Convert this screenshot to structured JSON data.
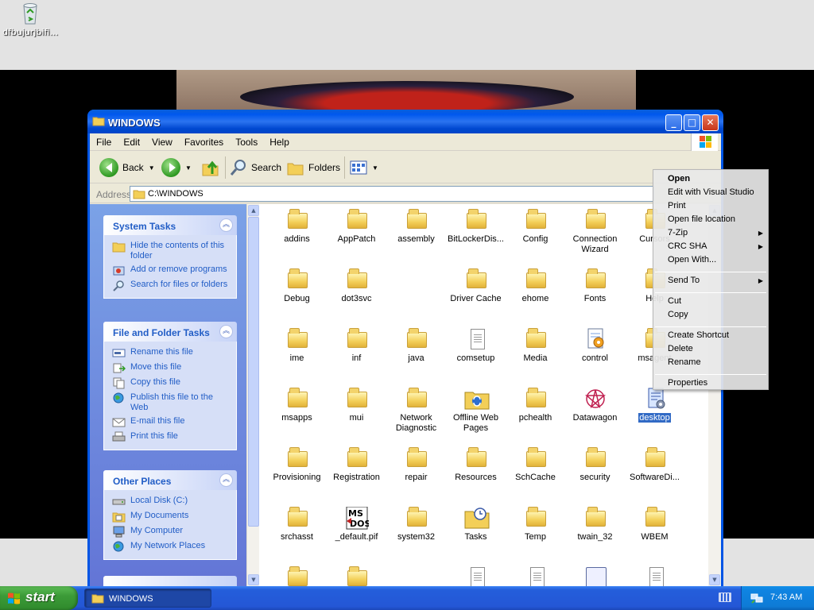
{
  "desktop": {
    "recycle_label": "dfbujurjbifi..."
  },
  "window": {
    "title": "WINDOWS",
    "menu": [
      "File",
      "Edit",
      "View",
      "Favorites",
      "Tools",
      "Help"
    ],
    "toolbar": {
      "back": "Back",
      "search": "Search",
      "folders": "Folders"
    },
    "address": {
      "label": "Address",
      "value": "C:\\WINDOWS"
    }
  },
  "left_pane": {
    "system_tasks": {
      "title": "System Tasks",
      "items": [
        {
          "label": "Hide the contents of this folder",
          "icon": "hide-folder-icon"
        },
        {
          "label": "Add or remove programs",
          "icon": "add-remove-programs-icon"
        },
        {
          "label": "Search for files or folders",
          "icon": "search-icon"
        }
      ]
    },
    "file_folder_tasks": {
      "title": "File and Folder Tasks",
      "items": [
        {
          "label": "Rename this file",
          "icon": "rename-icon"
        },
        {
          "label": "Move this file",
          "icon": "move-icon"
        },
        {
          "label": "Copy this file",
          "icon": "copy-icon"
        },
        {
          "label": "Publish this file to the Web",
          "icon": "publish-web-icon"
        },
        {
          "label": "E-mail this file",
          "icon": "email-icon"
        },
        {
          "label": "Print this file",
          "icon": "print-icon"
        }
      ]
    },
    "other_places": {
      "title": "Other Places",
      "items": [
        {
          "label": "Local Disk (C:)",
          "icon": "disk-icon"
        },
        {
          "label": "My Documents",
          "icon": "documents-icon"
        },
        {
          "label": "My Computer",
          "icon": "computer-icon"
        },
        {
          "label": "My Network Places",
          "icon": "network-icon"
        }
      ]
    }
  },
  "files": [
    {
      "name": "addins",
      "type": "folder"
    },
    {
      "name": "AppPatch",
      "type": "folder"
    },
    {
      "name": "assembly",
      "type": "folder"
    },
    {
      "name": "BitLockerDis...",
      "type": "folder"
    },
    {
      "name": "Config",
      "type": "folder"
    },
    {
      "name": "Connection Wizard",
      "type": "folder"
    },
    {
      "name": "Cursors",
      "type": "folder"
    },
    {
      "name": "Debug",
      "type": "folder"
    },
    {
      "name": "dot3svc",
      "type": "folder"
    },
    {
      "name": "",
      "type": "blank"
    },
    {
      "name": "Driver Cache",
      "type": "folder"
    },
    {
      "name": "ehome",
      "type": "folder"
    },
    {
      "name": "Fonts",
      "type": "folder"
    },
    {
      "name": "Help",
      "type": "folder"
    },
    {
      "name": "ime",
      "type": "folder"
    },
    {
      "name": "inf",
      "type": "folder"
    },
    {
      "name": "java",
      "type": "folder"
    },
    {
      "name": "comsetup",
      "type": "document"
    },
    {
      "name": "Media",
      "type": "folder"
    },
    {
      "name": "control",
      "type": "control"
    },
    {
      "name": "msagent",
      "type": "folder"
    },
    {
      "name": "msapps",
      "type": "folder"
    },
    {
      "name": "mui",
      "type": "folder"
    },
    {
      "name": "Network Diagnostic",
      "type": "folder"
    },
    {
      "name": "Offline Web Pages",
      "type": "offline"
    },
    {
      "name": "pchealth",
      "type": "folder"
    },
    {
      "name": "Datawagon",
      "type": "datawagon"
    },
    {
      "name": "desktop",
      "type": "desktop-ini",
      "selected": true
    },
    {
      "name": "Provisioning",
      "type": "folder"
    },
    {
      "name": "Registration",
      "type": "folder"
    },
    {
      "name": "repair",
      "type": "folder"
    },
    {
      "name": "Resources",
      "type": "folder"
    },
    {
      "name": "SchCache",
      "type": "folder"
    },
    {
      "name": "security",
      "type": "folder"
    },
    {
      "name": "SoftwareDi...",
      "type": "folder"
    },
    {
      "name": "srchasst",
      "type": "folder"
    },
    {
      "name": "_default.pif",
      "type": "msdos"
    },
    {
      "name": "system32",
      "type": "folder"
    },
    {
      "name": "Tasks",
      "type": "tasks"
    },
    {
      "name": "Temp",
      "type": "folder"
    },
    {
      "name": "twain_32",
      "type": "folder"
    },
    {
      "name": "WBEM",
      "type": "folder"
    },
    {
      "name": "",
      "type": "folder"
    },
    {
      "name": "",
      "type": "folder"
    },
    {
      "name": "",
      "type": "blank"
    },
    {
      "name": "",
      "type": "document"
    },
    {
      "name": "",
      "type": "document"
    },
    {
      "name": "",
      "type": "bigdoc"
    },
    {
      "name": "",
      "type": "document"
    }
  ],
  "context_menu": {
    "items": [
      {
        "label": "Open",
        "bold": true
      },
      {
        "label": "Edit with Visual Studio"
      },
      {
        "label": "Print"
      },
      {
        "label": "Open file location"
      },
      {
        "label": "7-Zip",
        "submenu": true
      },
      {
        "label": "CRC SHA",
        "submenu": true
      },
      {
        "label": "Open With..."
      },
      {
        "separator": true
      },
      {
        "label": "Send To",
        "submenu": true
      },
      {
        "separator": true
      },
      {
        "label": "Cut"
      },
      {
        "label": "Copy"
      },
      {
        "separator": true
      },
      {
        "label": "Create Shortcut"
      },
      {
        "label": "Delete"
      },
      {
        "label": "Rename"
      },
      {
        "separator": true
      },
      {
        "label": "Properties"
      }
    ]
  },
  "taskbar": {
    "start": "start",
    "task": "WINDOWS",
    "clock": "7:43 AM"
  }
}
